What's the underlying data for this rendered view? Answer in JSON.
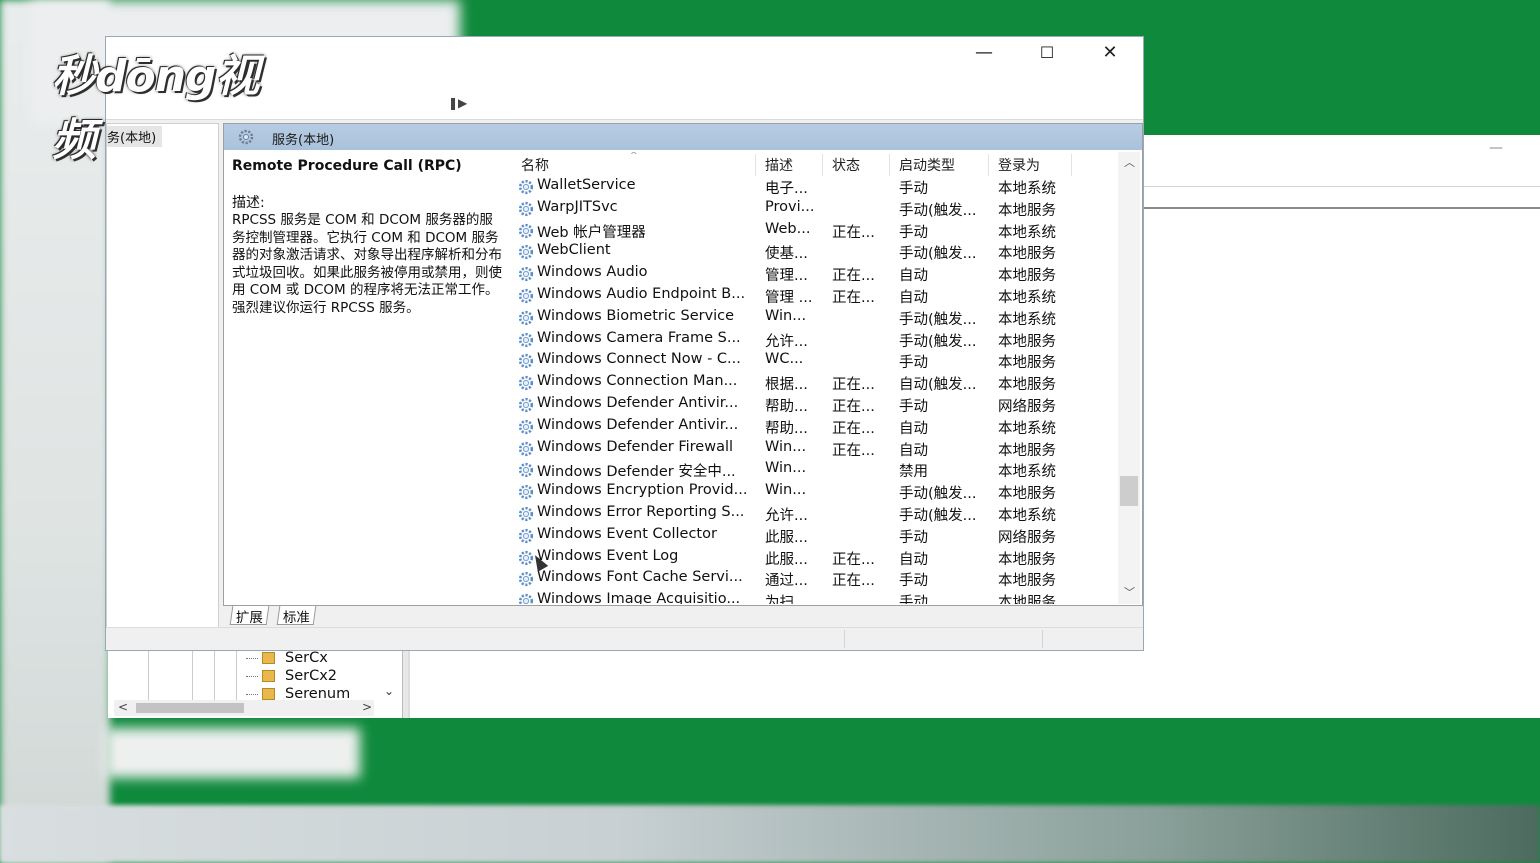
{
  "watermark": {
    "logo_text": "秒dōng视频"
  },
  "window": {
    "controls": {
      "minimize": "—",
      "maximize": "☐",
      "close": "✕"
    }
  },
  "nav": {
    "selected_item": "务(本地)"
  },
  "content_header": {
    "title": "服务(本地)"
  },
  "description": {
    "service_name": "Remote Procedure Call (RPC)",
    "label": "描述:",
    "text": "RPCSS 服务是 COM 和 DCOM 服务器的服务控制管理器。它执行 COM 和 DCOM 服务器的对象激活请求、对象导出程序解析和分布式垃圾回收。如果此服务被停用或禁用，则使用 COM 或 DCOM 的程序将无法正常工作。强烈建议你运行 RPCSS 服务。"
  },
  "columns": [
    "名称",
    "描述",
    "状态",
    "启动类型",
    "登录为"
  ],
  "services": [
    {
      "name": "WalletService",
      "desc": "电子...",
      "status": "",
      "startup": "手动",
      "logon": "本地系统"
    },
    {
      "name": "WarpJITSvc",
      "desc": "Provi...",
      "status": "",
      "startup": "手动(触发...",
      "logon": "本地服务"
    },
    {
      "name": "Web 帐户管理器",
      "desc": "Web...",
      "status": "正在...",
      "startup": "手动",
      "logon": "本地系统"
    },
    {
      "name": "WebClient",
      "desc": "使基...",
      "status": "",
      "startup": "手动(触发...",
      "logon": "本地服务"
    },
    {
      "name": "Windows Audio",
      "desc": "管理...",
      "status": "正在...",
      "startup": "自动",
      "logon": "本地服务"
    },
    {
      "name": "Windows Audio Endpoint B...",
      "desc": "管理 ...",
      "status": "正在...",
      "startup": "自动",
      "logon": "本地系统"
    },
    {
      "name": "Windows Biometric Service",
      "desc": "Win...",
      "status": "",
      "startup": "手动(触发...",
      "logon": "本地系统"
    },
    {
      "name": "Windows Camera Frame S...",
      "desc": "允许...",
      "status": "",
      "startup": "手动(触发...",
      "logon": "本地服务"
    },
    {
      "name": "Windows Connect Now - C...",
      "desc": "WC...",
      "status": "",
      "startup": "手动",
      "logon": "本地服务"
    },
    {
      "name": "Windows Connection Man...",
      "desc": "根据...",
      "status": "正在...",
      "startup": "自动(触发...",
      "logon": "本地服务"
    },
    {
      "name": "Windows Defender Antivir...",
      "desc": "帮助...",
      "status": "正在...",
      "startup": "手动",
      "logon": "网络服务"
    },
    {
      "name": "Windows Defender Antivir...",
      "desc": "帮助...",
      "status": "正在...",
      "startup": "自动",
      "logon": "本地系统"
    },
    {
      "name": "Windows Defender Firewall",
      "desc": "Win...",
      "status": "正在...",
      "startup": "自动",
      "logon": "本地服务"
    },
    {
      "name": "Windows Defender 安全中...",
      "desc": "Win...",
      "status": "",
      "startup": "禁用",
      "logon": "本地系统"
    },
    {
      "name": "Windows Encryption Provid...",
      "desc": "Win...",
      "status": "",
      "startup": "手动(触发...",
      "logon": "本地服务"
    },
    {
      "name": "Windows Error Reporting S...",
      "desc": "允许...",
      "status": "",
      "startup": "手动(触发...",
      "logon": "本地系统"
    },
    {
      "name": "Windows Event Collector",
      "desc": "此服...",
      "status": "",
      "startup": "手动",
      "logon": "网络服务"
    },
    {
      "name": "Windows Event Log",
      "desc": "此服...",
      "status": "正在...",
      "startup": "自动",
      "logon": "本地服务"
    },
    {
      "name": "Windows Font Cache Servi...",
      "desc": "通过...",
      "status": "正在...",
      "startup": "手动",
      "logon": "本地服务"
    },
    {
      "name": "Windows Image Acquisitio...",
      "desc": "为扫...",
      "status": "",
      "startup": "手动",
      "logon": "本地服务"
    }
  ],
  "tabs": [
    "扩展",
    "标准"
  ],
  "device_tree": [
    "SerCx",
    "SerCx2",
    "Serenum"
  ],
  "icons": {
    "service": "gear-icon",
    "header": "services-gear-icon",
    "folder": "folder-icon"
  },
  "colors": {
    "background": "#0f8a3c",
    "header_blue": "#b6cde3",
    "gear": "#5b8fc7"
  }
}
